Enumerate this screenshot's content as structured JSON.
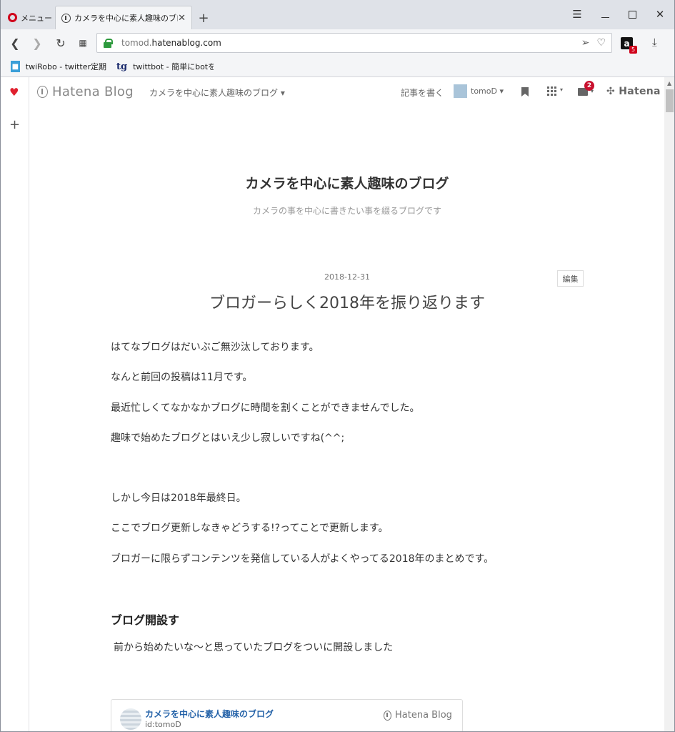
{
  "browser": {
    "menu_tab_label": "メニュー",
    "active_tab_title": "カメラを中心に素人趣味のブログ",
    "tab_close": "✕",
    "new_tab": "+",
    "url_domain_prefix": "tomod.",
    "url_domain_main": "hatenablog.com",
    "amazon_label": "a",
    "amazon_badge": "5",
    "bookmarks": [
      {
        "label": "twiRobo - twitter定期",
        "icon": "twirobo-icon"
      },
      {
        "label": "twittbot - 簡単にbotを",
        "icon": "tg-icon"
      }
    ],
    "bookmark_tg_glyph": "tg"
  },
  "hatena_header": {
    "logo_text": "Hatena Blog",
    "blog_name_menu": "カメラを中心に素人趣味のブログ",
    "write_label": "記事を書く",
    "user_name": "tomoD",
    "notification_count": "2",
    "hatena_label": "Hatena"
  },
  "blog": {
    "title": "カメラを中心に素人趣味のブログ",
    "description": "カメラの事を中心に書きたい事を綴るブログです"
  },
  "entry": {
    "date": "2018-12-31",
    "edit_label": "編集",
    "title": "ブロガーらしく2018年を振り返ります",
    "paragraphs": [
      "はてなブログはだいぶご無沙汰しております。",
      "なんと前回の投稿は11月です。",
      "最近忙しくてなかなかブログに時間を割くことができませんでした。",
      "趣味で始めたブログとはいえ少し寂しいですね(^^;",
      "しかし今日は2018年最終日。",
      "ここでブログ更新しなきゃどうする!?ってことで更新します。",
      "ブロガーに限らずコンテンツを発信している人がよくやってる2018年のまとめです。"
    ],
    "heading": "ブログ開設す",
    "heading_text": "前から始めたいな～と思っていたブログをついに開設しました"
  },
  "embed_card": {
    "title": "カメラを中心に素人趣味のブログ",
    "id_text": "id:tomoD",
    "logo_text": "Hatena Blog"
  },
  "colors": {
    "accent_red": "#d0021b",
    "link_blue": "#2462a8",
    "secure_green": "#2e9a3e"
  }
}
